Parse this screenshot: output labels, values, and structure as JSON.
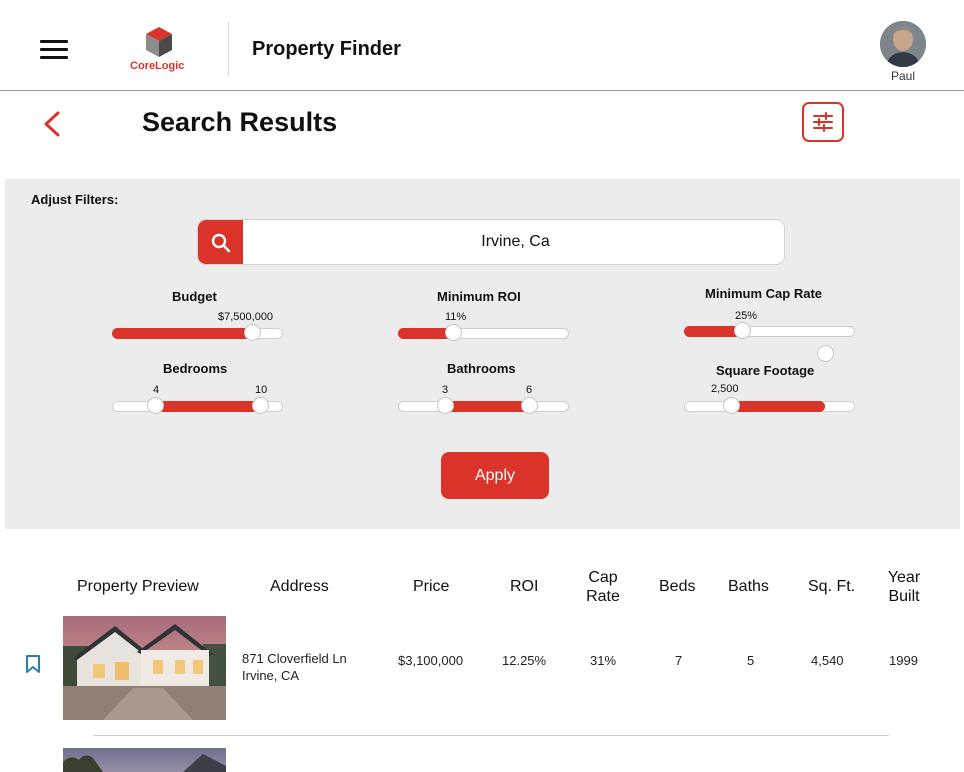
{
  "header": {
    "logo_text": "CoreLogic",
    "app_title": "Property Finder",
    "user_name": "Paul"
  },
  "subheader": {
    "title": "Search Results"
  },
  "filters": {
    "heading": "Adjust Filters:",
    "search_value": "Irvine, Ca",
    "budget": {
      "label": "Budget",
      "value": "$7,500,000",
      "level": 0.82
    },
    "min_roi": {
      "label": "Minimum ROI",
      "value": "11%",
      "level": 0.32
    },
    "min_cap_rate": {
      "label": "Minimum Cap Rate",
      "value": "25%",
      "level": 0.34
    },
    "bedrooms": {
      "label": "Bedrooms",
      "min": "4",
      "max": "10",
      "range": [
        0.25,
        0.87
      ]
    },
    "bathrooms": {
      "label": "Bathrooms",
      "min": "3",
      "max": "6",
      "range": [
        0.27,
        0.77
      ]
    },
    "square_footage": {
      "label": "Square Footage",
      "value": "2,500",
      "range": [
        0.27,
        0.83
      ]
    },
    "apply_label": "Apply"
  },
  "table": {
    "headers": {
      "preview": "Property Preview",
      "address": "Address",
      "price": "Price",
      "roi": "ROI",
      "cap_rate_1": "Cap",
      "cap_rate_2": "Rate",
      "beds": "Beds",
      "baths": "Baths",
      "sqft": "Sq. Ft.",
      "year_1": "Year",
      "year_2": "Built"
    },
    "rows": [
      {
        "address_line1": "871 Cloverfield Ln",
        "address_line2": "Irvine, CA",
        "price": "$3,100,000",
        "roi": "12.25%",
        "cap_rate": "31%",
        "beds": "7",
        "baths": "5",
        "sqft": "4,540",
        "year_built": "1999"
      }
    ]
  },
  "colors": {
    "accent": "#d9332a",
    "panel_bg": "#ececec",
    "bookmark": "#2a7fb0"
  },
  "icons": {
    "menu": "hamburger-menu-icon",
    "back": "chevron-left-icon",
    "filter": "sliders-icon",
    "search": "search-icon",
    "bookmark": "bookmark-outline-icon"
  }
}
